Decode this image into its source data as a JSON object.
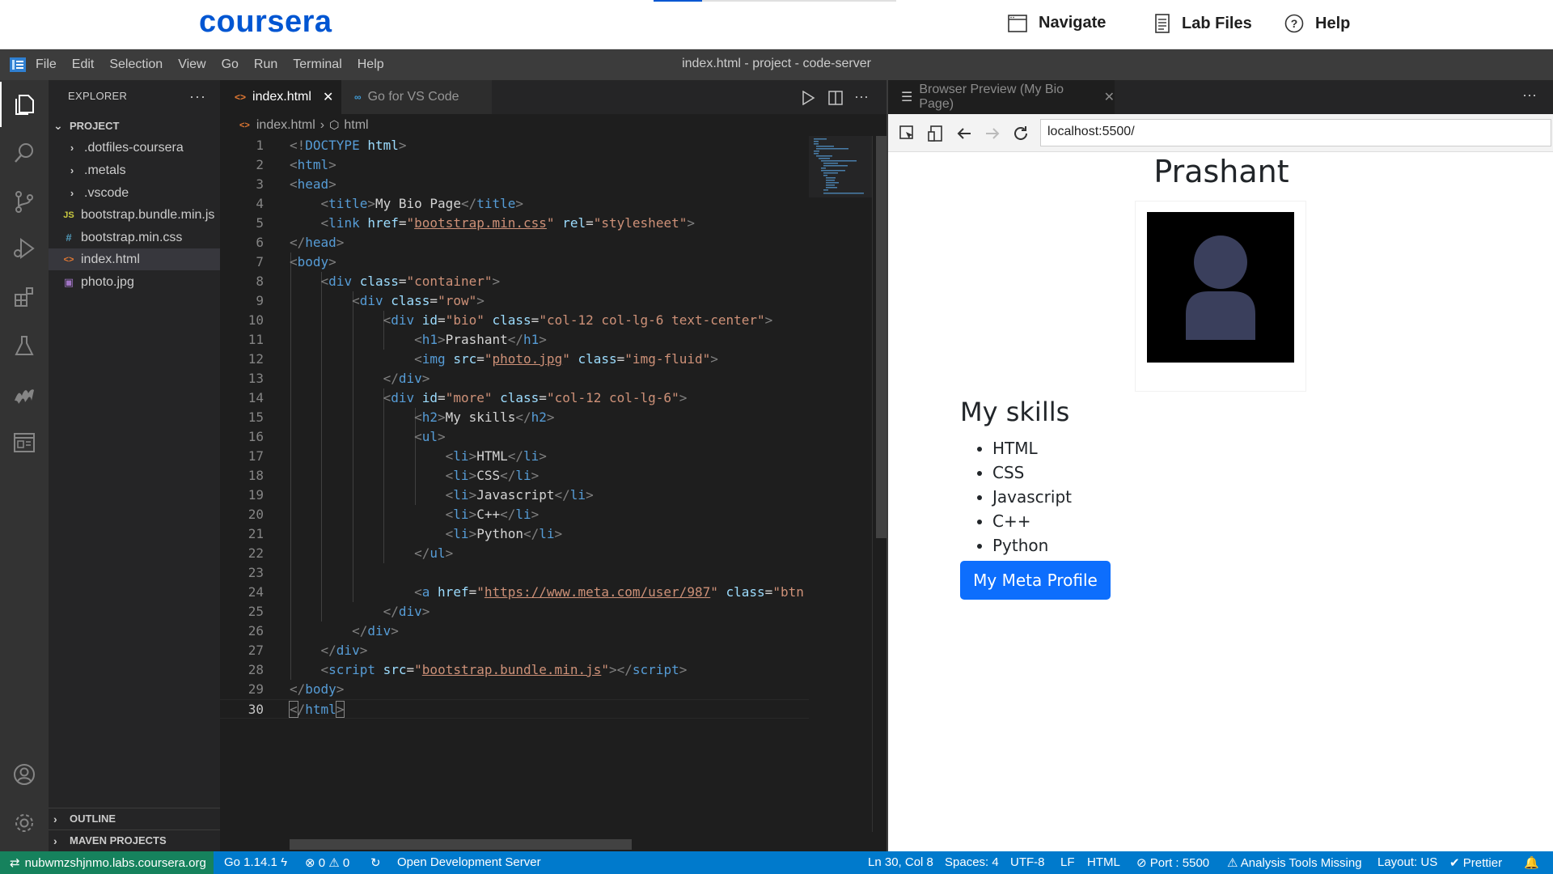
{
  "coursera": {
    "logo": "coursera",
    "progress_fraction": 0.2,
    "nav": [
      {
        "label": "Navigate",
        "icon": "browser-window-icon"
      },
      {
        "label": "Lab Files",
        "icon": "file-list-icon"
      },
      {
        "label": "Help",
        "icon": "question-circle-icon"
      }
    ]
  },
  "menubar": {
    "menus": [
      "File",
      "Edit",
      "Selection",
      "View",
      "Go",
      "Run",
      "Terminal",
      "Help"
    ],
    "title": "index.html - project - code-server"
  },
  "sidebar": {
    "header": "EXPLORER",
    "more": "···",
    "project_label": "PROJECT",
    "items": [
      {
        "label": ".dotfiles-coursera",
        "type": "folder"
      },
      {
        "label": ".metals",
        "type": "folder"
      },
      {
        "label": ".vscode",
        "type": "folder"
      },
      {
        "label": "bootstrap.bundle.min.js",
        "type": "js",
        "icon_text": "JS"
      },
      {
        "label": "bootstrap.min.css",
        "type": "css",
        "icon_text": "#"
      },
      {
        "label": "index.html",
        "type": "html",
        "icon_text": "<>"
      },
      {
        "label": "photo.jpg",
        "type": "image",
        "icon_text": "▣"
      }
    ],
    "outline_label": "OUTLINE",
    "maven_label": "MAVEN PROJECTS"
  },
  "editor": {
    "tabs": [
      {
        "label": "index.html",
        "close": "✕",
        "active": true
      },
      {
        "label": "Go for VS Code",
        "active": false
      }
    ],
    "breadcrumb": {
      "file": "index.html",
      "separator": "›",
      "node": "html"
    },
    "cursor_line": 30
  },
  "preview": {
    "tab_label": "Browser Preview (My Bio Page)",
    "tab_close": "✕",
    "more": "···",
    "url": "localhost:5500/",
    "page": {
      "heading": "Prashant",
      "skills_heading": "My skills",
      "skills": [
        "HTML",
        "CSS",
        "Javascript",
        "C++",
        "Python"
      ],
      "button": "My Meta Profile"
    },
    "colors": {
      "button": "#0d6efd",
      "avatar": "#3a3f5c"
    }
  },
  "statusbar": {
    "remote": "nubwmzshjnmo.labs.coursera.org",
    "go_version": "Go 1.14.1",
    "errors": "0",
    "warnings": "0",
    "open_server": "Open Development Server",
    "position": "Ln 30, Col 8",
    "spaces": "Spaces: 4",
    "encoding": "UTF-8",
    "eol": "LF",
    "language": "HTML",
    "port": "Port : 5500",
    "analysis": "Analysis Tools Missing",
    "layout": "Layout: US",
    "prettier": "Prettier"
  },
  "colors": {
    "activity_bar": "#333333",
    "sidebar": "#252526",
    "editor": "#1e1e1e",
    "status_bar": "#007acc",
    "remote_badge": "#16825d",
    "coursera_blue": "#0056d2"
  }
}
